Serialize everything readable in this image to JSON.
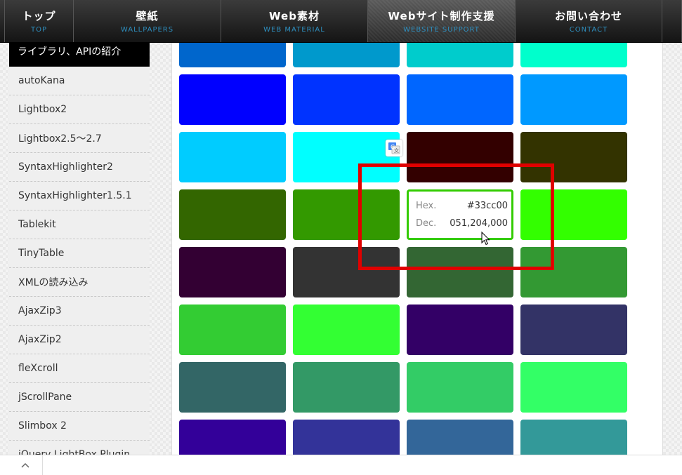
{
  "nav": [
    {
      "jp": "トップ",
      "en": "TOP",
      "active": false
    },
    {
      "jp": "壁紙",
      "en": "WALLPAPERS",
      "active": false
    },
    {
      "jp": "Web素材",
      "en": "WEB MATERIAL",
      "active": false
    },
    {
      "jp": "Webサイト制作支援",
      "en": "WEBSITE SUPPORT",
      "active": true
    },
    {
      "jp": "お問い合わせ",
      "en": "CONTACT",
      "active": false
    }
  ],
  "sidebar": {
    "heading_cut": "…ライブラリ、APIの紹介",
    "heading": "ライブラリ、APIの紹介",
    "items": [
      "autoKana",
      "Lightbox2",
      "Lightbox2.5～2.7",
      "SyntaxHighlighter2",
      "SyntaxHighlighter1.5.1",
      "Tablekit",
      "TinyTable",
      "XMLの読み込み",
      "AjaxZip3",
      "AjaxZip2",
      "fleXcroll",
      "jScrollPane",
      "Slimbox 2",
      "jQuery LightBox Plugin"
    ]
  },
  "swatches": [
    [
      "#0066cc",
      "#0099cc",
      "#00cccc",
      "#00ffcc"
    ],
    [
      "#0000ff",
      "#0033ff",
      "#0066ff",
      "#0099ff"
    ],
    [
      "#00ccff",
      "#00ffff",
      "#330000",
      "#333300"
    ],
    [
      "#336600",
      "#339900",
      "#33cc00",
      "#33ff00"
    ],
    [
      "#330033",
      "#333333",
      "#336633",
      "#339933"
    ],
    [
      "#33cc33",
      "#33ff33",
      "#330066",
      "#333366"
    ],
    [
      "#336666",
      "#339966",
      "#33cc66",
      "#33ff66"
    ],
    [
      "#330099",
      "#333399",
      "#336699",
      "#339999"
    ]
  ],
  "tooltip": {
    "hex_label": "Hex.",
    "hex_value": "#33cc00",
    "dec_label": "Dec.",
    "dec_value": "051,204,000",
    "border_color": "#33cc00"
  },
  "icons": {
    "translate": "google-translate-icon",
    "cursor": "mouse-pointer-icon",
    "up": "chevron-up-icon"
  },
  "highlight_color": "#e00000"
}
